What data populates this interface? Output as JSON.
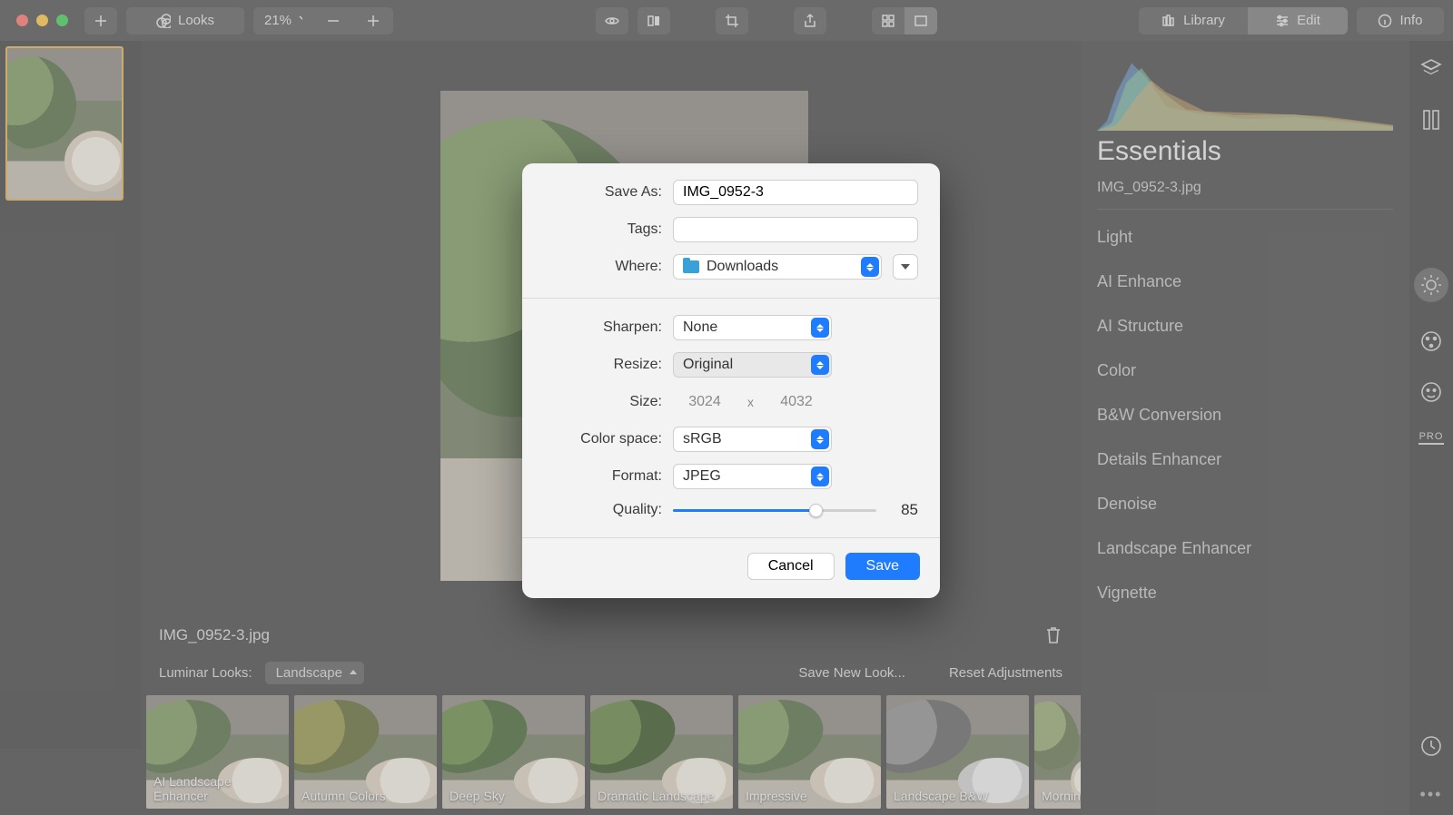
{
  "toolbar": {
    "looks": "Looks",
    "zoom": "21%",
    "library": "Library",
    "edit": "Edit",
    "info": "Info"
  },
  "canvas_file": "IMG_0952-3.jpg",
  "looks_bar": {
    "label": "Luminar Looks:",
    "category": "Landscape",
    "save_new": "Save New Look...",
    "reset": "Reset Adjustments"
  },
  "looks": [
    "AI Landscape Enhancer",
    "Autumn Colors",
    "Deep Sky",
    "Dramatic Landscape",
    "Impressive",
    "Landscape B&W",
    "Morning"
  ],
  "right": {
    "title": "Essentials",
    "file": "IMG_0952-3.jpg",
    "items": [
      "Light",
      "AI Enhance",
      "AI Structure",
      "Color",
      "B&W Conversion",
      "Details Enhancer",
      "Denoise",
      "Landscape Enhancer",
      "Vignette"
    ],
    "pro": "PRO"
  },
  "modal": {
    "save_as_label": "Save As:",
    "save_as_value": "IMG_0952-3",
    "tags_label": "Tags:",
    "tags_value": "",
    "where_label": "Where:",
    "where_value": "Downloads",
    "sharpen_label": "Sharpen:",
    "sharpen_value": "None",
    "resize_label": "Resize:",
    "resize_value": "Original",
    "size_label": "Size:",
    "size_w": "3024",
    "size_x": "x",
    "size_h": "4032",
    "colorspace_label": "Color space:",
    "colorspace_value": "sRGB",
    "format_label": "Format:",
    "format_value": "JPEG",
    "quality_label": "Quality:",
    "quality_value": "85",
    "quality_pct": 70,
    "cancel": "Cancel",
    "save": "Save"
  }
}
